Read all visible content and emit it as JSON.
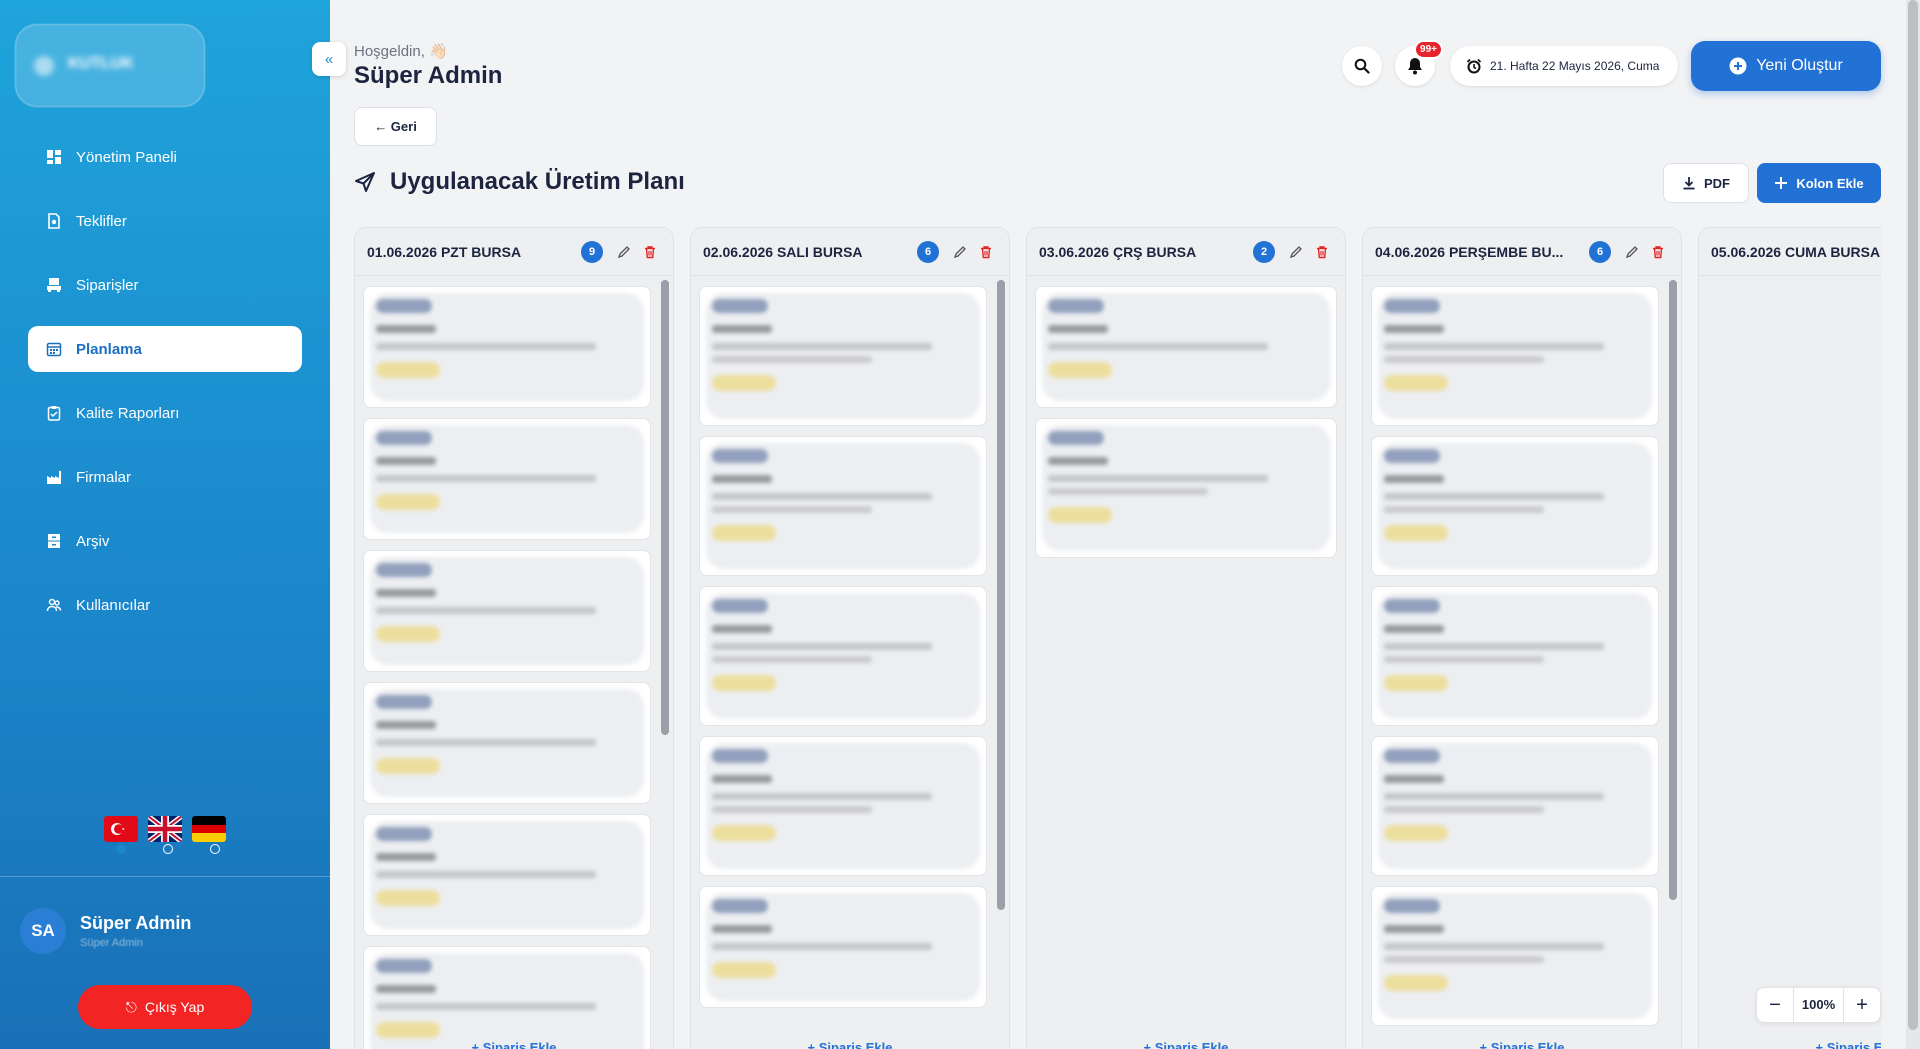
{
  "sidebar": {
    "brand": "KUTLUK",
    "brand_sub": "",
    "collapse_icon": "chevrons-left-icon",
    "items": [
      {
        "label": "Yönetim Paneli",
        "icon": "dashboard-icon"
      },
      {
        "label": "Teklifler",
        "icon": "document-icon"
      },
      {
        "label": "Siparişler",
        "icon": "order-icon"
      },
      {
        "label": "Planlama",
        "icon": "calendar-icon",
        "active": true
      },
      {
        "label": "Kalite Raporları",
        "icon": "clipboard-icon"
      },
      {
        "label": "Firmalar",
        "icon": "factory-icon"
      },
      {
        "label": "Arşiv",
        "icon": "archive-icon"
      },
      {
        "label": "Kullanıcılar",
        "icon": "users-icon"
      }
    ],
    "languages": [
      "tr",
      "en",
      "de"
    ],
    "selected_language": "tr",
    "user": {
      "initials": "SA",
      "name": "Süper Admin",
      "role": "Süper Admin"
    },
    "logout_label": "Çıkış Yap"
  },
  "header": {
    "greeting": "Hoşgeldin, 👋🏻",
    "user_title": "Süper Admin",
    "notification_count": "99+",
    "date_text": "21. Hafta 22 Mayıs 2026, Cuma",
    "new_button": "Yeni Oluştur"
  },
  "page": {
    "back_label": "← Geri",
    "title": "Uygulanacak Üretim Planı",
    "pdf_label": "PDF",
    "add_column_label": "Kolon Ekle"
  },
  "columns": [
    {
      "title": "01.06.2026 PZT BURSA",
      "count": "9",
      "cards": 6,
      "add_label": "+ Sipariş Ekle"
    },
    {
      "title": "02.06.2026 SALI BURSA",
      "count": "6",
      "cards": 5,
      "add_label": "+ Sipariş Ekle"
    },
    {
      "title": "03.06.2026 ÇRŞ BURSA",
      "count": "2",
      "cards": 2,
      "add_label": "+ Sipariş Ekle"
    },
    {
      "title": "04.06.2026 PERŞEMBE BU...",
      "count": "6",
      "cards": 5,
      "add_label": "+ Sipariş Ekle"
    },
    {
      "title": "05.06.2026 CUMA BURSA",
      "count": "",
      "cards": 0,
      "add_label": "+ Sipariş Ekle"
    }
  ],
  "zoom": {
    "value": "100%"
  },
  "colors": {
    "accent": "#2272d6",
    "danger": "#f22424",
    "sidebar_top": "#1fa4db",
    "sidebar_bottom": "#1a70b6"
  }
}
